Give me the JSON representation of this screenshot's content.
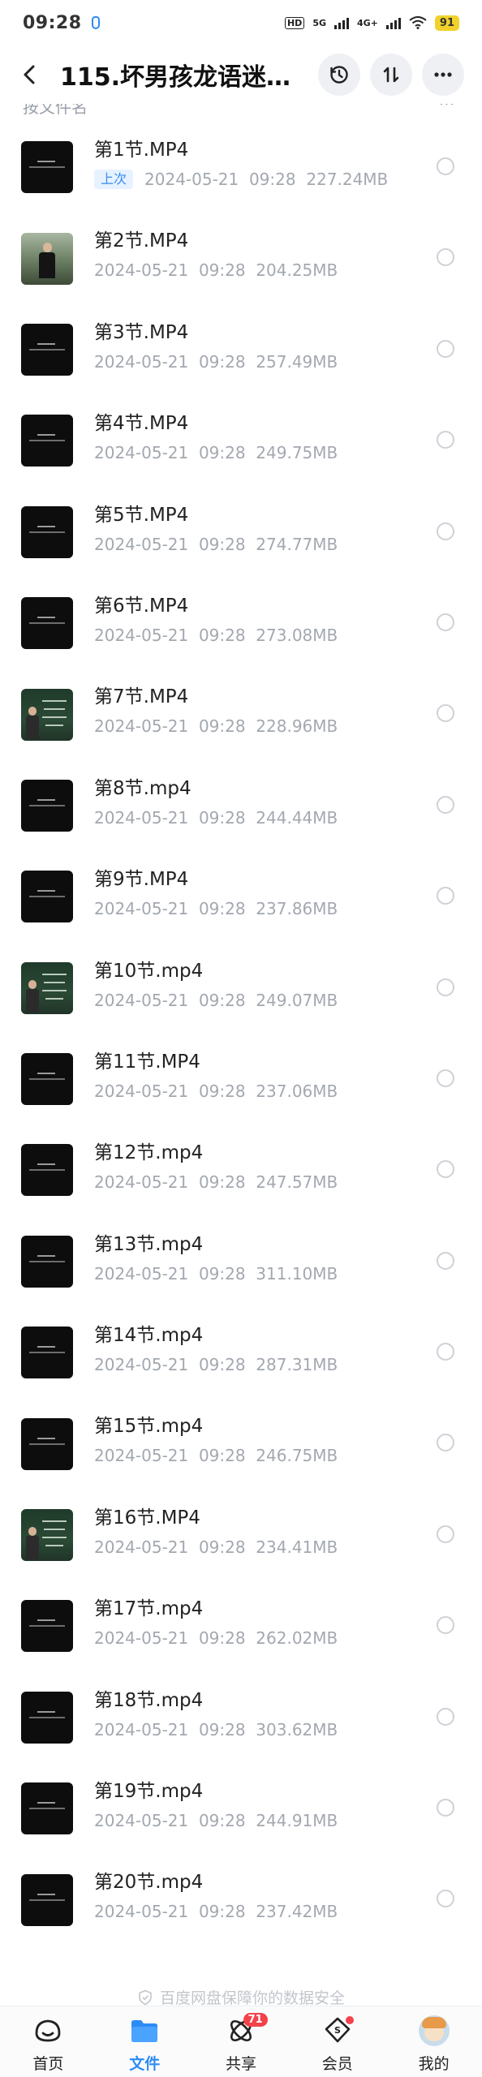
{
  "status_bar": {
    "time": "09:28",
    "network": "5G",
    "network2": "4G+",
    "battery": "91",
    "hd": "HD"
  },
  "header": {
    "title": "115.坏男孩龙语迷…",
    "sort_label": "按文件名",
    "sort_more": "···"
  },
  "files": [
    {
      "name": "第1节.MP4",
      "meta": "2024-05-21  09:28  227.24MB",
      "tag": "上次",
      "thumb": "dark"
    },
    {
      "name": "第2节.MP4",
      "meta": "2024-05-21  09:28  204.25MB",
      "thumb": "photo"
    },
    {
      "name": "第3节.MP4",
      "meta": "2024-05-21  09:28  257.49MB",
      "thumb": "dark"
    },
    {
      "name": "第4节.MP4",
      "meta": "2024-05-21  09:28  249.75MB",
      "thumb": "dark"
    },
    {
      "name": "第5节.MP4",
      "meta": "2024-05-21  09:28  274.77MB",
      "thumb": "dark"
    },
    {
      "name": "第6节.MP4",
      "meta": "2024-05-21  09:28  273.08MB",
      "thumb": "dark"
    },
    {
      "name": "第7节.MP4",
      "meta": "2024-05-21  09:28  228.96MB",
      "thumb": "board"
    },
    {
      "name": "第8节.mp4",
      "meta": "2024-05-21  09:28  244.44MB",
      "thumb": "dark"
    },
    {
      "name": "第9节.MP4",
      "meta": "2024-05-21  09:28  237.86MB",
      "thumb": "dark"
    },
    {
      "name": "第10节.mp4",
      "meta": "2024-05-21  09:28  249.07MB",
      "thumb": "board"
    },
    {
      "name": "第11节.MP4",
      "meta": "2024-05-21  09:28  237.06MB",
      "thumb": "dark"
    },
    {
      "name": "第12节.mp4",
      "meta": "2024-05-21  09:28  247.57MB",
      "thumb": "dark"
    },
    {
      "name": "第13节.mp4",
      "meta": "2024-05-21  09:28  311.10MB",
      "thumb": "dark"
    },
    {
      "name": "第14节.mp4",
      "meta": "2024-05-21  09:28  287.31MB",
      "thumb": "dark"
    },
    {
      "name": "第15节.mp4",
      "meta": "2024-05-21  09:28  246.75MB",
      "thumb": "dark"
    },
    {
      "name": "第16节.MP4",
      "meta": "2024-05-21  09:28  234.41MB",
      "thumb": "board"
    },
    {
      "name": "第17节.mp4",
      "meta": "2024-05-21  09:28  262.02MB",
      "thumb": "dark"
    },
    {
      "name": "第18节.mp4",
      "meta": "2024-05-21  09:28  303.62MB",
      "thumb": "dark"
    },
    {
      "name": "第19节.mp4",
      "meta": "2024-05-21  09:28  244.91MB",
      "thumb": "dark"
    },
    {
      "name": "第20节.mp4",
      "meta": "2024-05-21  09:28  237.42MB",
      "thumb": "dark"
    }
  ],
  "footer_note": "百度网盘保障你的数据安全",
  "tabs": [
    {
      "label": "首页",
      "icon": "home-icon"
    },
    {
      "label": "文件",
      "icon": "folder-icon",
      "active": true
    },
    {
      "label": "共享",
      "icon": "share-icon",
      "badge": "71"
    },
    {
      "label": "会员",
      "icon": "vip-icon",
      "dot": true
    },
    {
      "label": "我的",
      "icon": "avatar-icon"
    }
  ],
  "colors": {
    "accent": "#2c8cf5",
    "badge": "#f3424a",
    "meta_text": "#a3a8b0"
  }
}
